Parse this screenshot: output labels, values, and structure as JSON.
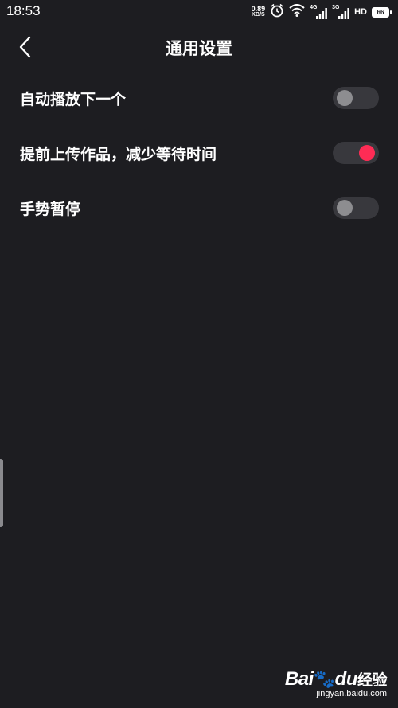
{
  "status_bar": {
    "time": "18:53",
    "net_speed_value": "0.89",
    "net_speed_unit": "KB/S",
    "sim1_tag": "4G",
    "sim2_tag": "3G",
    "hd_tag": "HD",
    "battery_level": "66"
  },
  "header": {
    "title": "通用设置"
  },
  "settings": [
    {
      "label": "自动播放下一个",
      "enabled": false
    },
    {
      "label": "提前上传作品，减少等待时间",
      "enabled": true
    },
    {
      "label": "手势暂停",
      "enabled": false
    }
  ],
  "colors": {
    "background": "#1d1d21",
    "toggle_track": "#38383d",
    "toggle_knob_off": "#8d8d90",
    "toggle_knob_on": "#fe2c55"
  },
  "watermark": {
    "logo_bai": "Bai",
    "logo_du": "du",
    "logo_cn": "经验",
    "url": "jingyan.baidu.com"
  }
}
